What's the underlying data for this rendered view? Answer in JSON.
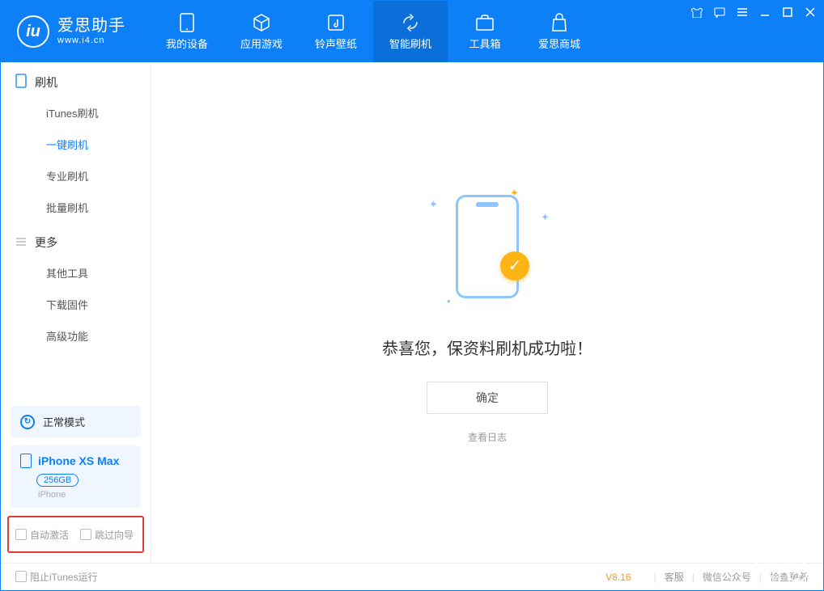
{
  "app": {
    "name": "爱思助手",
    "url": "www.i4.cn"
  },
  "tabs": [
    {
      "label": "我的设备"
    },
    {
      "label": "应用游戏"
    },
    {
      "label": "铃声壁纸"
    },
    {
      "label": "智能刷机"
    },
    {
      "label": "工具箱"
    },
    {
      "label": "爱思商城"
    }
  ],
  "sidebar": {
    "section1": "刷机",
    "items1": [
      "iTunes刷机",
      "一键刷机",
      "专业刷机",
      "批量刷机"
    ],
    "section2": "更多",
    "items2": [
      "其他工具",
      "下载固件",
      "高级功能"
    ]
  },
  "device_panel": {
    "mode": "正常模式",
    "device_name": "iPhone XS Max",
    "capacity": "256GB",
    "device_type": "iPhone"
  },
  "bottom_opts": {
    "auto_activate": "自动激活",
    "skip_guide": "跳过向导"
  },
  "main": {
    "title": "恭喜您，保资料刷机成功啦！",
    "confirm": "确定",
    "view_log": "查看日志"
  },
  "status": {
    "block_itunes": "阻止iTunes运行",
    "version": "V8.16",
    "cs": "客服",
    "wechat": "微信公众号",
    "update": "检查更新"
  }
}
